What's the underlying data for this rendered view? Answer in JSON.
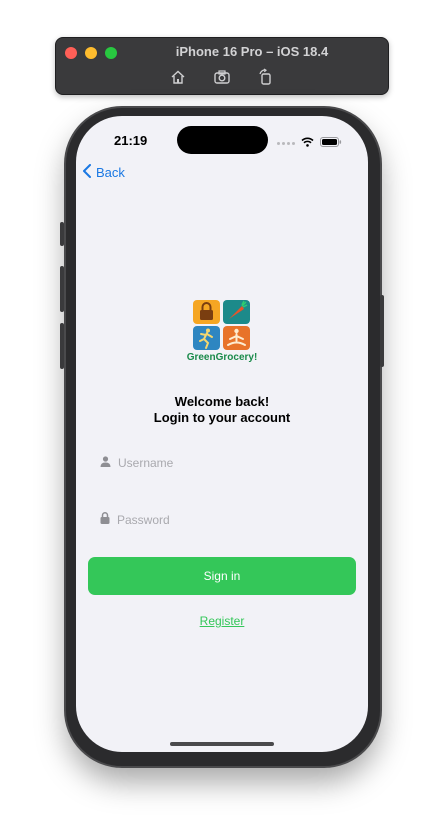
{
  "simulator": {
    "title": "iPhone 16 Pro – iOS 18.4",
    "tools": [
      "home-icon",
      "screenshot-icon",
      "rotate-icon"
    ]
  },
  "status_bar": {
    "time": "21:19",
    "icons": [
      "cellular-dots-icon",
      "wifi-icon",
      "battery-icon"
    ]
  },
  "nav": {
    "back_label": "Back"
  },
  "logo": {
    "text": "GreenGrocery!"
  },
  "welcome": {
    "line1": "Welcome back!",
    "line2": "Login to your account"
  },
  "form": {
    "username": {
      "placeholder": "Username",
      "value": ""
    },
    "password": {
      "placeholder": "Password",
      "value": ""
    },
    "signin_label": "Sign in",
    "register_label": "Register"
  },
  "colors": {
    "accent_green": "#34c759",
    "link_blue": "#1a78e3",
    "screen_bg": "#f2f2f7"
  }
}
